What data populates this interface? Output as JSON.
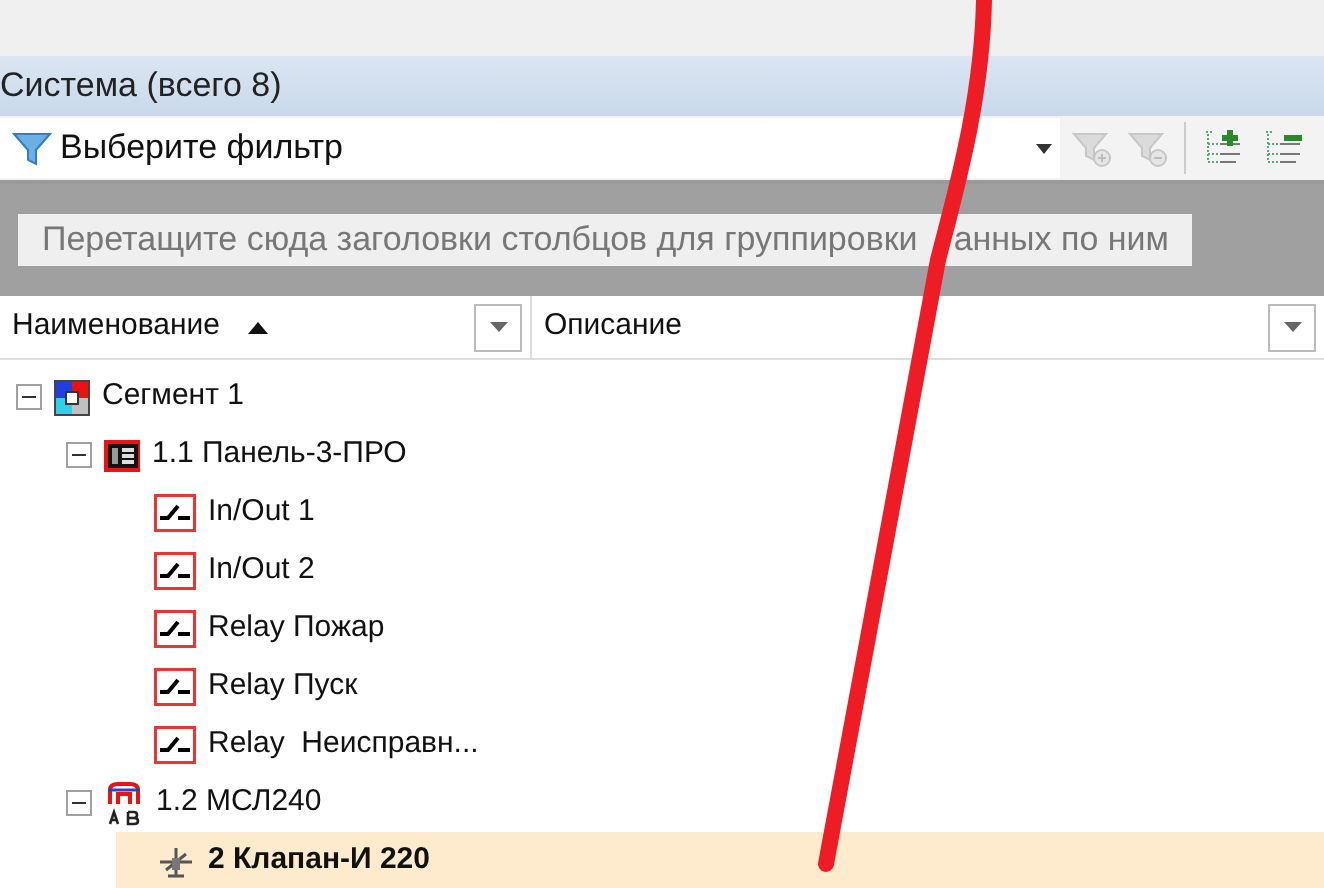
{
  "panel": {
    "title": "Система (всего 8)"
  },
  "toolbar": {
    "filter": {
      "placeholder": "Выберите фильтр"
    },
    "buttons": [
      {
        "kind": "filter-add",
        "disabled": true
      },
      {
        "kind": "filter-remove",
        "disabled": true
      },
      {
        "kind": "expand-all",
        "disabled": false
      },
      {
        "kind": "collapse-all",
        "disabled": false
      }
    ]
  },
  "group_panel": {
    "hint_left_of_stroke": "Перетащите сюда заголовки столбцов для группировки",
    "hint_right_of_stroke": "анных по ним"
  },
  "columns": [
    {
      "label": "Наименование",
      "sorted_ascending": true
    },
    {
      "label": "Описание",
      "sorted_ascending": false
    }
  ],
  "tree": [
    {
      "kind": "segment",
      "label": "Сегмент 1",
      "expanded": true,
      "selected": false,
      "children": [
        {
          "kind": "panel",
          "label": "1.1 Панель-3-ПРО",
          "expanded": true,
          "selected": false,
          "children": [
            {
              "kind": "relay",
              "label": "In/Out 1",
              "selected": false
            },
            {
              "kind": "relay",
              "label": "In/Out 2",
              "selected": false
            },
            {
              "kind": "relay",
              "label": "Relay Пожар",
              "selected": false
            },
            {
              "kind": "relay",
              "label": "Relay Пуск",
              "selected": false
            },
            {
              "kind": "relay",
              "label": "Relay  Неисправн...",
              "selected": false
            }
          ]
        },
        {
          "kind": "module",
          "label": "1.2 МСЛ240",
          "expanded": true,
          "selected": false,
          "children": [
            {
              "kind": "valve",
              "label": "2 Клапан-И 220",
              "selected": true
            }
          ]
        }
      ]
    }
  ]
}
